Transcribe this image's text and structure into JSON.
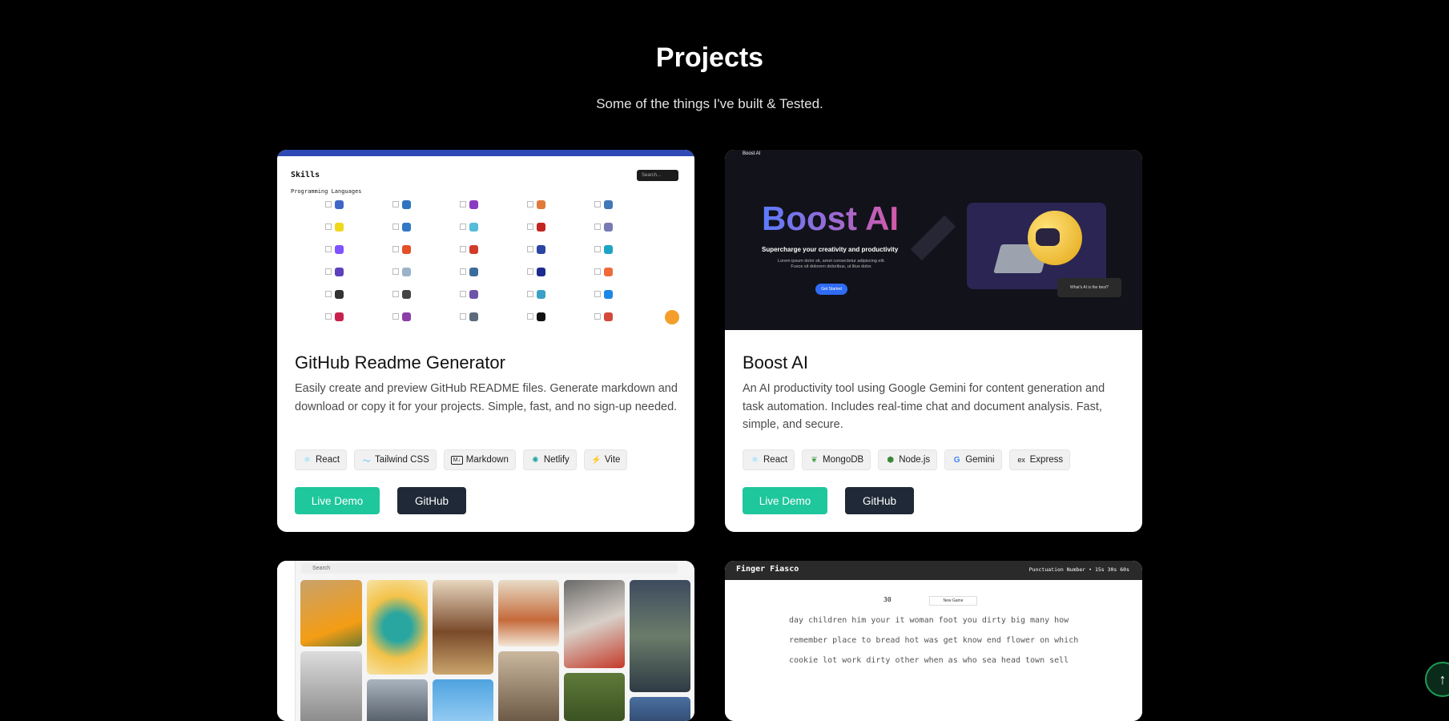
{
  "section": {
    "title": "Projects",
    "subtitle": "Some of the things I've built & Tested."
  },
  "projects": [
    {
      "title": "GitHub Readme Generator",
      "description": "Easily create and preview GitHub README files. Generate markdown and download or copy it for your projects. Simple, fast, and no sign-up needed.",
      "tags": [
        {
          "label": "React",
          "icon": "react-icon"
        },
        {
          "label": "Tailwind CSS",
          "icon": "tailwind-icon"
        },
        {
          "label": "Markdown",
          "icon": "markdown-icon"
        },
        {
          "label": "Netlify",
          "icon": "netlify-icon"
        },
        {
          "label": "Vite",
          "icon": "vite-icon"
        }
      ],
      "demo_label": "Live Demo",
      "github_label": "GitHub",
      "screenshot": {
        "heading": "Skills",
        "subheading": "Programming Languages",
        "search_placeholder": "Search..."
      }
    },
    {
      "title": "Boost AI",
      "description": "An AI productivity tool using Google Gemini for content generation and task automation. Includes real-time chat and document analysis. Fast, simple, and secure.",
      "tags": [
        {
          "label": "React",
          "icon": "react-icon"
        },
        {
          "label": "MongoDB",
          "icon": "mongodb-icon"
        },
        {
          "label": "Node.js",
          "icon": "nodejs-icon"
        },
        {
          "label": "Gemini",
          "icon": "google-icon"
        },
        {
          "label": "Express",
          "icon": "express-icon"
        }
      ],
      "demo_label": "Live Demo",
      "github_label": "GitHub",
      "screenshot": {
        "brand": "Boost AI",
        "headline": "Boost AI",
        "tagline": "Supercharge your creativity and productivity",
        "lorem": "Lorem ipsum dolor sit, amet consectetur adipiscing elit. Fusce sit dolorem doloribus, ut litus dolor.",
        "cta": "Get Started",
        "bubble": "What's AI is the best?"
      }
    },
    {
      "screenshot": {
        "search_placeholder": "Search"
      }
    },
    {
      "screenshot": {
        "app_title": "Finger Fiasco",
        "options": "Punctuation  Number  •  15s  30s  60s",
        "timer": "30",
        "new_game": "New Game",
        "words": "day children him your it woman foot you dirty big many how remember place to bread hot was get know end flower on which cookie lot work dirty other when as who sea head town sell"
      }
    }
  ],
  "colors": {
    "background": "#000000",
    "demo_button": "#1ec79c",
    "github_button": "#1f2937"
  }
}
